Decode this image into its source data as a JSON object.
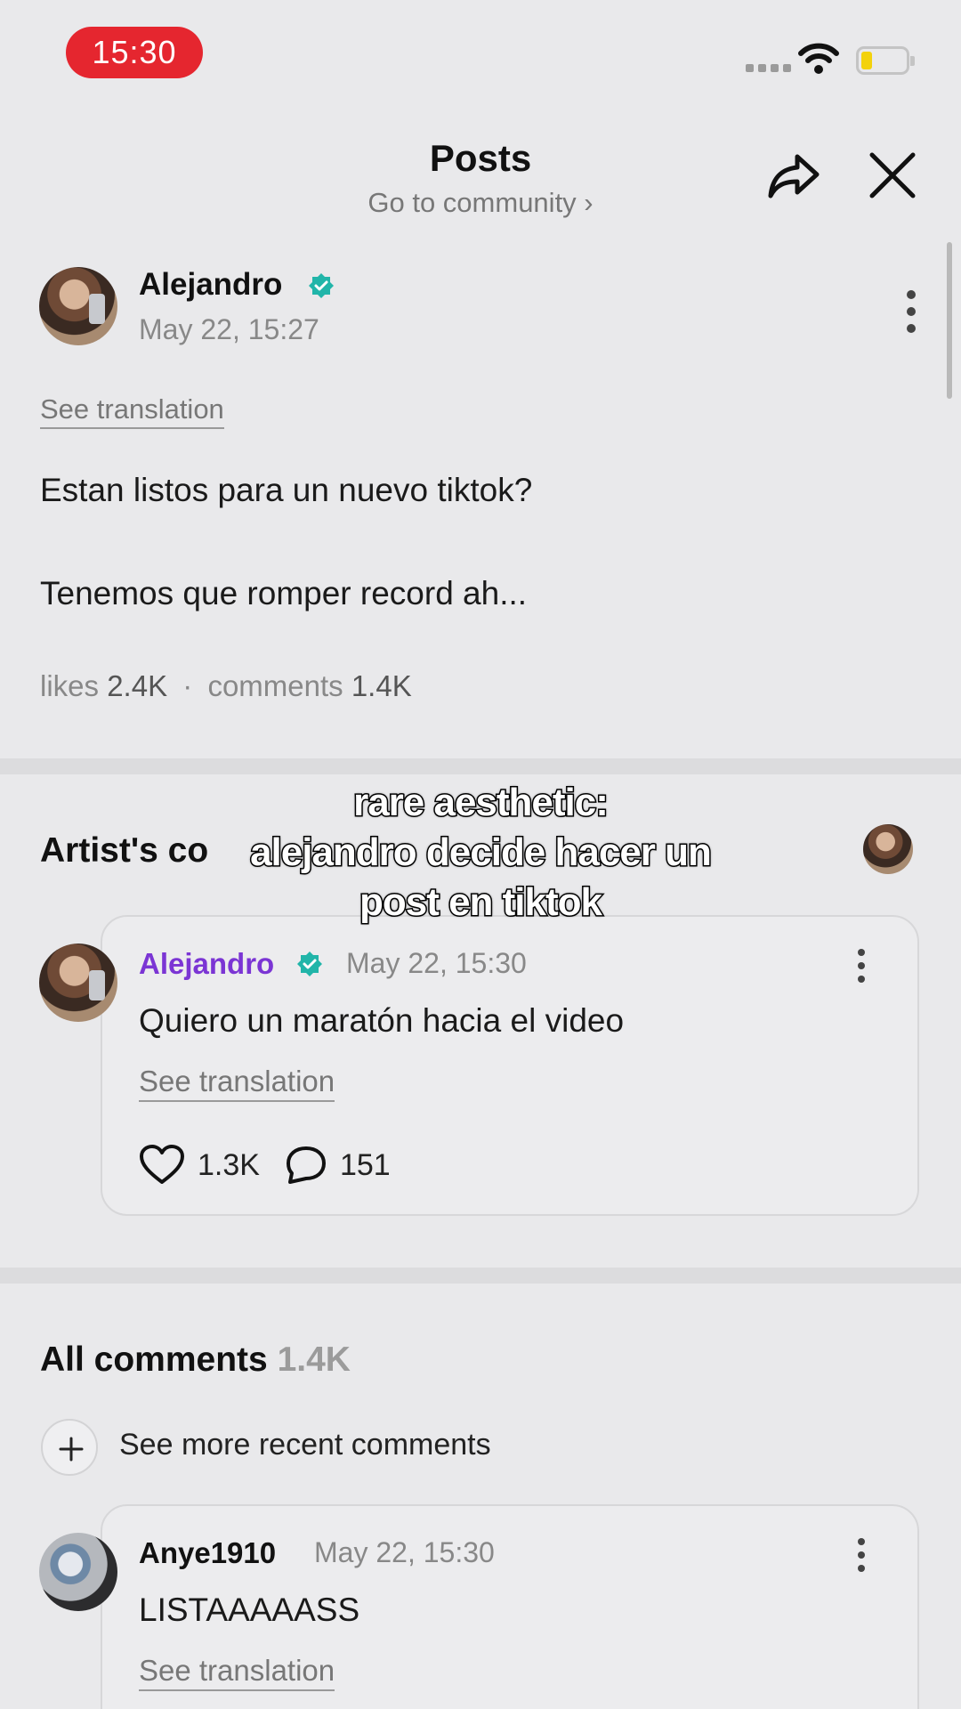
{
  "status_bar": {
    "time": "15:30"
  },
  "header": {
    "title": "Posts",
    "subtitle": "Go to community ›"
  },
  "post": {
    "author": "Alejandro",
    "date": "May 22, 15:27",
    "see_translation": "See translation",
    "line1": "Estan listos para un nuevo tiktok?",
    "line2": "Tenemos que romper record ah...",
    "likes_label": "likes",
    "likes_count": "2.4K",
    "separator": "·",
    "comments_label": "comments",
    "comments_count": "1.4K"
  },
  "artist_comments": {
    "title": "Artist's co",
    "comment": {
      "author": "Alejandro",
      "date": "May 22, 15:30",
      "text": "Quiero un maratón hacia el video",
      "see_translation": "See translation",
      "likes": "1.3K",
      "replies": "151"
    }
  },
  "all_comments": {
    "title": "All comments",
    "count": "1.4K",
    "see_more": "See more recent comments",
    "comment": {
      "author": "Anye1910",
      "date": "May 22, 15:30",
      "text": "LISTAAAAASS",
      "see_translation": "See translation"
    }
  },
  "caption": {
    "line1": "rare aesthetic:",
    "line2": "alejandro decide hacer un",
    "line3": "post en tiktok"
  },
  "colors": {
    "accent_name": "#7b35d4",
    "verified": "#21b5a9",
    "time_pill": "#e5262f"
  }
}
